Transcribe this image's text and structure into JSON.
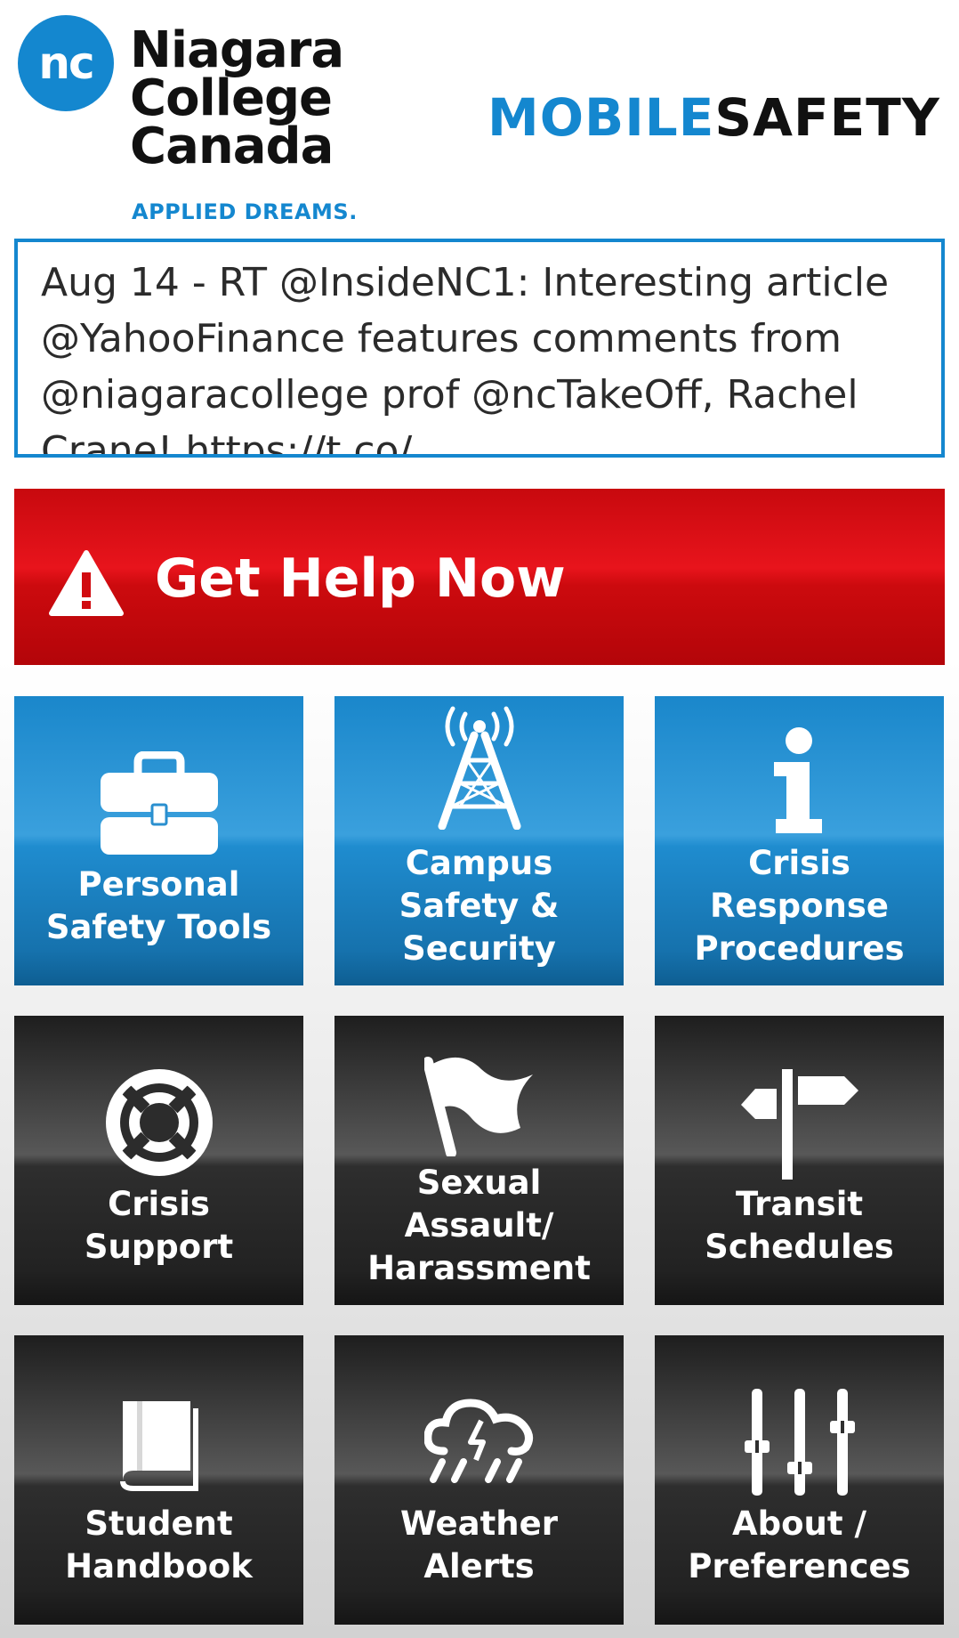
{
  "header": {
    "badge": "nc",
    "college_line1": "Niagara",
    "college_line2": "College",
    "college_line3": "Canada",
    "tagline": "APPLIED DREAMS.",
    "app_title_part1": "MOBILE",
    "app_title_part2": "SAFETY"
  },
  "ticker": {
    "text": "Aug 14 - RT @InsideNC1: Interesting article @YahooFinance features comments from @niagaracollege prof @ncTakeOff, Rachel Crane! https://t.co/"
  },
  "help_button": {
    "label": "Get Help Now",
    "icon": "warning-triangle-icon"
  },
  "tiles": [
    {
      "line1": "Personal",
      "line2": "Safety Tools",
      "line3": "",
      "icon": "toolbox-icon"
    },
    {
      "line1": "Campus",
      "line2": "Safety &",
      "line3": "Security",
      "icon": "radio-tower-icon"
    },
    {
      "line1": "Crisis",
      "line2": "Response",
      "line3": "Procedures",
      "icon": "info-icon"
    },
    {
      "line1": "Crisis",
      "line2": "Support",
      "line3": "",
      "icon": "lifebuoy-icon"
    },
    {
      "line1": "Sexual",
      "line2": "Assault/",
      "line3": "Harassment",
      "icon": "flag-icon"
    },
    {
      "line1": "Transit",
      "line2": "Schedules",
      "line3": "",
      "icon": "signpost-icon"
    },
    {
      "line1": "Student",
      "line2": "Handbook",
      "line3": "",
      "icon": "book-icon"
    },
    {
      "line1": "Weather",
      "line2": "Alerts",
      "line3": "",
      "icon": "rain-cloud-icon"
    },
    {
      "line1": "About /",
      "line2": "Preferences",
      "line3": "",
      "icon": "sliders-icon"
    }
  ],
  "colors": {
    "brand_blue": "#1487cf",
    "help_red": "#e8141c",
    "tile_dark": "#2e2e2e"
  }
}
